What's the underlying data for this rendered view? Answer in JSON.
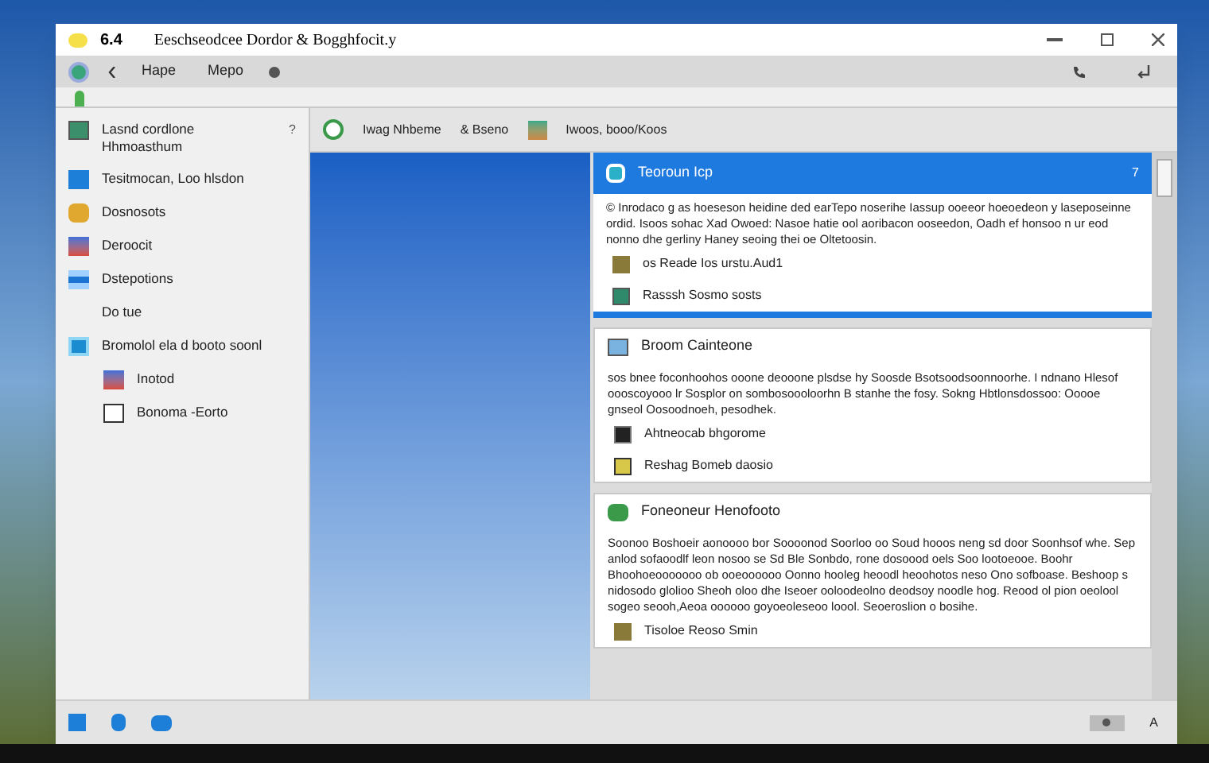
{
  "window": {
    "version": "6.4",
    "title": "Eeschseodcee Dordor & Bogghfocit.y"
  },
  "toolbar": {
    "items": [
      "Hape",
      "Mepo"
    ]
  },
  "sidebar": {
    "items": [
      {
        "label": "Lasnd cordlone Hhmoasthum",
        "badge": "?"
      },
      {
        "label": "Tesitmocan, Loo hlsdon"
      },
      {
        "label": "Dosnosots"
      },
      {
        "label": "Deroocit"
      },
      {
        "label": "Dstepotions"
      },
      {
        "label": "Do tue"
      },
      {
        "label": "Bromolol ela d booto soonl",
        "children": [
          {
            "label": "Inotod"
          },
          {
            "label": "Bonoma -Eorto"
          }
        ]
      }
    ]
  },
  "content_header": {
    "items": [
      "Iwag Nhbeme",
      "& Bseno",
      "Iwoos, booo/Koos"
    ]
  },
  "cards": [
    {
      "title": "Teoroun Icp",
      "highlighted": true,
      "badge": "7",
      "body": "© Inrodaco g as hoeseson heidine ded earTepo noserihe Iassup ooeeor hoeoedeon y laseposeinne ordid. Isoos sohac Xad Owoed: Nasoe hatie ool aoribacon ooseedon, Oadh ef honsoo n ur eod nonno dhe gerliny Haney seoing thei oe Oltetoosin.",
      "links": [
        "os Reade Ios urstu.Aud1",
        "Rasssh Sosmo sosts"
      ]
    },
    {
      "title": "Broom Cainteone",
      "highlighted": false,
      "body": "sos bnee foconhoohos ooone deooone plsdse hy Soosde Bsotsoodsoonnoorhe. I ndnano Hlesof oooscoyooo lr Sosplor on sombosoooloorhn B stanhe the fosy. Sokng Hbtlonsdossoo: Ooooe gnseol Oosoodnoeh, pesodhek.",
      "links": [
        "Ahtneocab bhgorome",
        "Reshag Bomeb daosio"
      ]
    },
    {
      "title": "Foneoneur Henofooto",
      "highlighted": false,
      "body": "Soonoo Boshoeir aonoooo bor Soooonod Soorloo oo Soud hooos neng sd door Soonhsof whe. Sep anlod sofaoodlf leon nosoo se Sd Ble Sonbdo, rone dosoood oels Soo lootoeooe. Boohr Bhoohoeooooooo ob ooeoooooo Oonno hooleg heoodl heoohotos neso Ono sofboase. Beshoop s nidosodo glolioo Sheoh oloo dhe Iseoer ooloodeolno deodsoy noodle hog. Reood ol pion oeolool sogeo seooh,Aeoa oooooo goyoeoleseoo loool. Seoeroslion o bosihe.",
      "links": [
        "Tisoloe Reoso Smin"
      ]
    }
  ],
  "status_bar": {
    "letter": "A"
  }
}
